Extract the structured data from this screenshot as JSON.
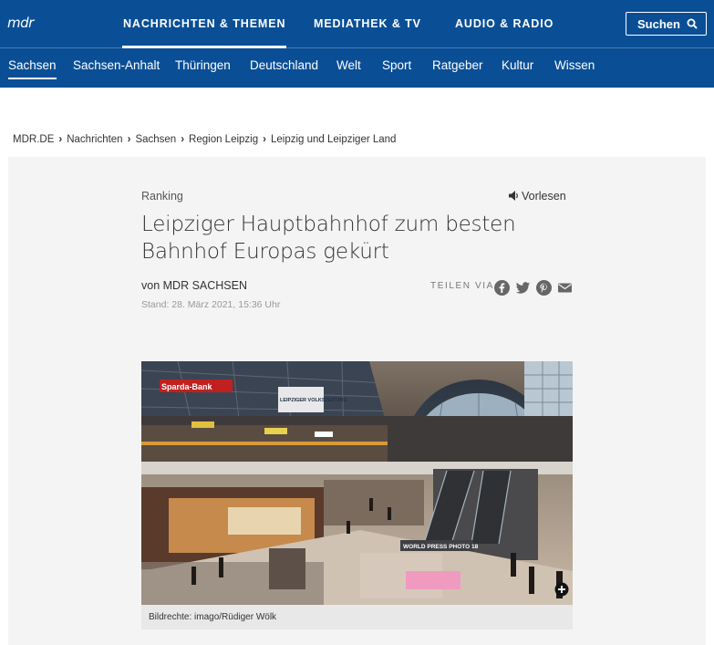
{
  "header": {
    "logo_text": "mdr",
    "main_nav": [
      "NACHRICHTEN & THEMEN",
      "MEDIATHEK & TV",
      "AUDIO & RADIO"
    ],
    "search_label": "Suchen",
    "sub_nav": [
      "Sachsen",
      "Sachsen-Anhalt",
      "Thüringen",
      "Deutschland",
      "Welt",
      "Sport",
      "Ratgeber",
      "Kultur",
      "Wissen"
    ],
    "brand_color": "#0a4f96"
  },
  "breadcrumb": [
    "MDR.DE",
    "Nachrichten",
    "Sachsen",
    "Region Leipzig",
    "Leipzig und Leipziger Land"
  ],
  "article": {
    "topic": "Ranking",
    "vorlesen": "Vorlesen",
    "headline": "Leipziger Hauptbahnhof zum besten Bahnhof Europas gekürt",
    "author": "von MDR SACHSEN",
    "stand": "Stand: 28. März 2021, 15:36 Uhr",
    "share_label": "TEILEN VIA",
    "share_icons": [
      "facebook-icon",
      "twitter-icon",
      "pinterest-icon",
      "mail-icon"
    ],
    "image_caption": "Bildrechte: imago/Rüdiger Wölk",
    "photo_signs": [
      "Sparda-Bank",
      "LEIPZIGER VOLKSZEITUNG",
      "WORLD PRESS PHOTO 18"
    ]
  }
}
